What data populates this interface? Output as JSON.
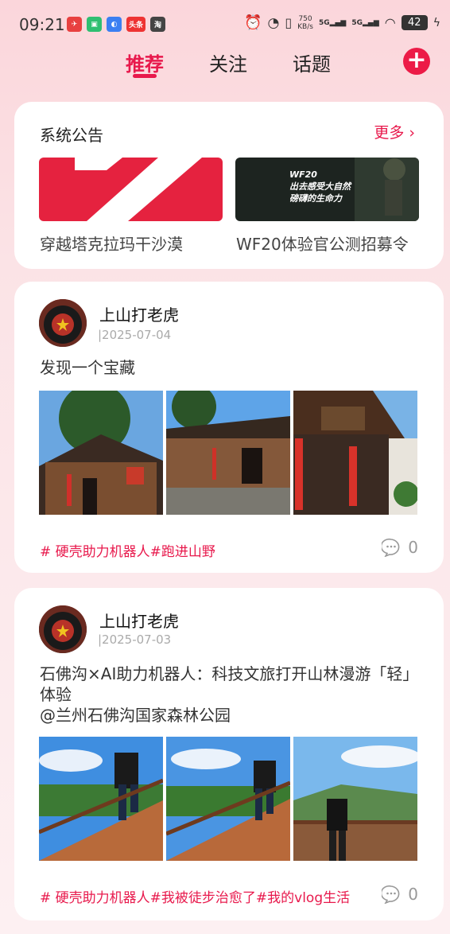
{
  "status_bar": {
    "time": "09:21",
    "notif_labels": [
      "头条",
      "淘"
    ],
    "net_speed_value": "750",
    "net_speed_unit": "KB/s",
    "sim1": "5G",
    "sim2": "5G",
    "battery": "42"
  },
  "tabs": [
    {
      "label": "推荐",
      "active": true
    },
    {
      "label": "关注",
      "active": false
    },
    {
      "label": "话题",
      "active": false
    }
  ],
  "accent_color": "#e8194c",
  "announcements": {
    "title": "系统公告",
    "more_label": "更多",
    "items": [
      {
        "caption": "穿越塔克拉玛干沙漠"
      },
      {
        "caption": "WF20体验官公测招募令",
        "image_text": [
          "WF20",
          "出去感受大自然",
          "磅礴的生命力"
        ]
      }
    ]
  },
  "posts": [
    {
      "user": "上山打老虎",
      "date": "|2025-07-04",
      "text": "发现一个宝藏",
      "tags": "# 硬壳助力机器人#跑进山野",
      "comments": "0"
    },
    {
      "user": "上山打老虎",
      "date": "|2025-07-03",
      "text": "石佛沟×AI助力机器人：科技文旅打开山林漫游「轻」体验\n@兰州石佛沟国家森林公园",
      "tags": "# 硬壳助力机器人#我被徒步治愈了#我的vlog生活",
      "comments": "0"
    }
  ]
}
